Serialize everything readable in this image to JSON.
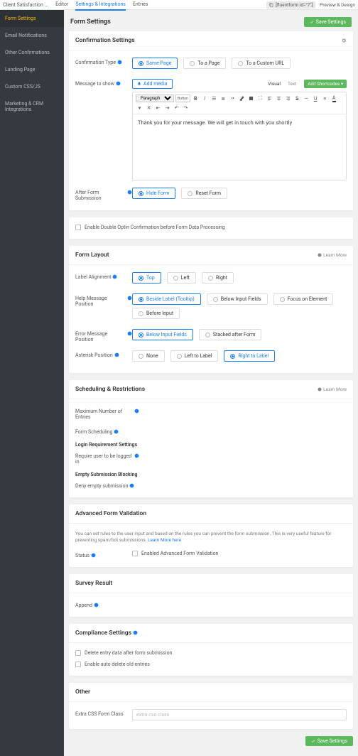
{
  "topbar": {
    "title": "Client Satisfaction ...",
    "nav": {
      "editor": "Editor",
      "settings": "Settings & Integrations",
      "entries": "Entries"
    },
    "shortcode": "[fluentform id=\"7\"]",
    "preview": "Preview & Design"
  },
  "sidebar": {
    "items": [
      "Form Settings",
      "Email Notifications",
      "Other Confirmations",
      "Landing Page",
      "Custom CSS/JS",
      "Marketing & CRM Integrations"
    ]
  },
  "page": {
    "title": "Form Settings",
    "save": "Save Settings"
  },
  "confirmation": {
    "heading": "Confirmation Settings",
    "type_label": "Confirmation Type",
    "types": {
      "same": "Same Page",
      "page": "To a Page",
      "url": "To a Custom URL"
    },
    "msg_label": "Message to show",
    "add_media": "Add media",
    "tabs": {
      "visual": "Visual",
      "text": "Text"
    },
    "shortcodes_btn": "Add Shortcodes",
    "format_sel": "Paragraph",
    "button_btn": "Button",
    "body": "Thank you for your message. We will get in touch with you shortly",
    "after_label": "After Form Submission",
    "after": {
      "hide": "Hide Form",
      "reset": "Reset Form"
    }
  },
  "double_optin": {
    "label": "Enable Double Optin Confirmation before Form Data Processing"
  },
  "layout": {
    "heading": "Form Layout",
    "learn_more": "Learn More",
    "align_label": "Label Alignment",
    "align": {
      "top": "Top",
      "left": "Left",
      "right": "Right"
    },
    "help_label": "Help Message Position",
    "help": {
      "beside": "Beside Label (Tooltip)",
      "below": "Below Input Fields",
      "focus": "Focus on Element",
      "before": "Before Input"
    },
    "error_label": "Error Message Position",
    "error": {
      "below": "Below Input Fields",
      "stacked": "Stacked after Form"
    },
    "ast_label": "Asterisk Position",
    "ast": {
      "none": "None",
      "left": "Left to Label",
      "right": "Right to Label"
    }
  },
  "sched": {
    "heading": "Scheduling & Restrictions",
    "learn_more": "Learn More",
    "max_label": "Maximum Number of Entries",
    "sched_label": "Form Scheduling",
    "login_hdr": "Login Requirement Settings",
    "login_req": "Require user to be logged in",
    "empty_hdr": "Empty Submission Blocking",
    "deny_empty": "Deny empty submission"
  },
  "adv": {
    "heading": "Advanced Form Validation",
    "desc": "You can set rules to the user input and based on the rules you can prevent the form submission. This is very useful feature for preventing spam/bot submissions. ",
    "link": "Learn More here",
    "status_label": "Status",
    "enable": "Enabled Advanced Form Validation"
  },
  "survey": {
    "heading": "Survey Result",
    "append": "Append"
  },
  "compliance": {
    "heading": "Compliance Settings",
    "del_after": "Delete entry data after form submission",
    "auto_del": "Enable auto delete old entries"
  },
  "other": {
    "heading": "Other",
    "css_label": "Extra CSS Form Class",
    "css_ph": "extra css class"
  }
}
